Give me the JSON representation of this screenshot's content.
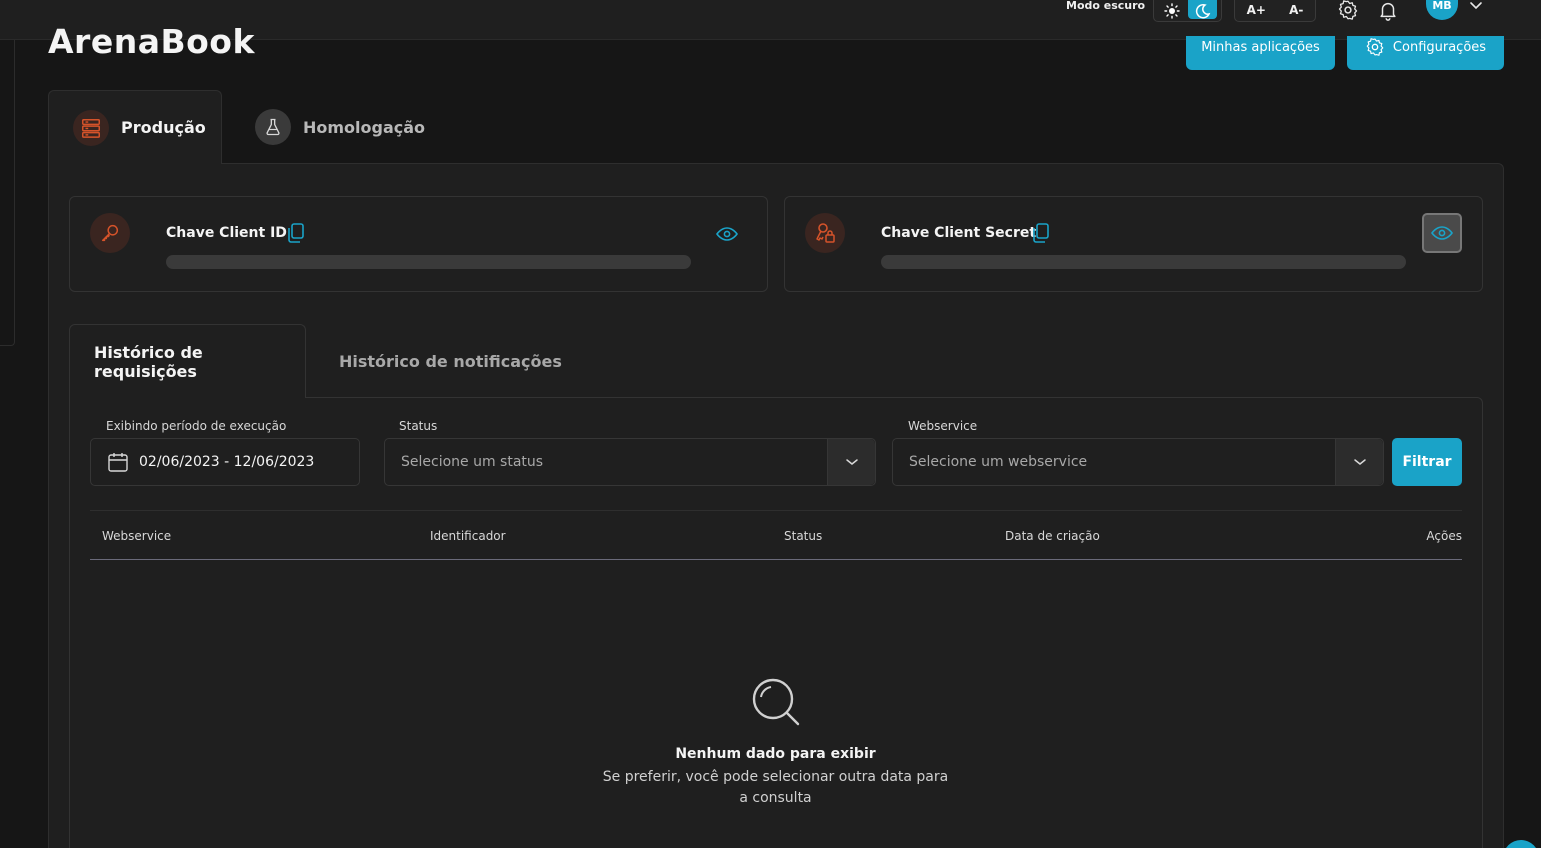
{
  "topbar": {
    "dark_mode_label": "Modo escuro",
    "font_increase": "A+",
    "font_decrease": "A-",
    "avatar_initials": "MB"
  },
  "header": {
    "app_title": "ArenaBook",
    "my_apps_label": "Minhas aplicações",
    "settings_label": "Configurações"
  },
  "env_tabs": [
    {
      "label": "Produção",
      "active": true
    },
    {
      "label": "Homologação",
      "active": false
    }
  ],
  "keys": {
    "client_id_title": "Chave Client ID",
    "client_secret_title": "Chave Client Secret"
  },
  "history_tabs": [
    {
      "label": "Histórico de requisições",
      "active": true
    },
    {
      "label": "Histórico de notificações",
      "active": false
    }
  ],
  "filters": {
    "period_label": "Exibindo período de execução",
    "period_value": "02/06/2023 - 12/06/2023",
    "status_label": "Status",
    "status_placeholder": "Selecione um status",
    "webservice_label": "Webservice",
    "webservice_placeholder": "Selecione um webservice",
    "filter_button": "Filtrar"
  },
  "table": {
    "columns": [
      "Webservice",
      "Identificador",
      "Status",
      "Data de criação",
      "Ações"
    ]
  },
  "empty_state": {
    "title": "Nenhum dado para exibir",
    "subtitle": "Se preferir, você pode selecionar outra data para a consulta"
  },
  "colors": {
    "accent": "#1aa3c8",
    "key_icon": "#d5532a",
    "background": "#161616",
    "panel": "#1f1f1f"
  }
}
